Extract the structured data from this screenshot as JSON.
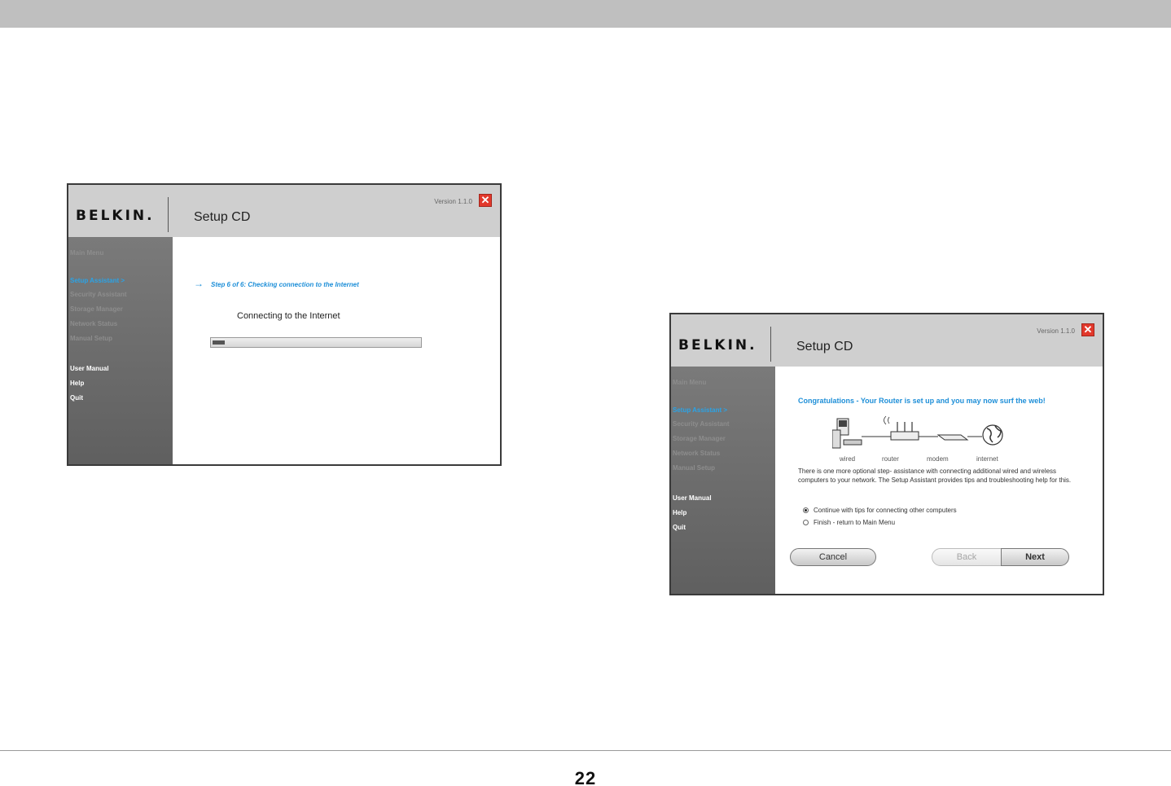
{
  "page": {
    "number": "22"
  },
  "app": {
    "logo": "BELKIN.",
    "title": "Setup CD",
    "version": "Version 1.1.0",
    "close_icon": "✕"
  },
  "sidebar": {
    "main_menu": "Main Menu",
    "setup_assistant": "Setup Assistant  >",
    "security_assistant": "Security Assistant",
    "storage_manager": "Storage Manager",
    "network_status": "Network Status",
    "manual_setup": "Manual Setup",
    "user_manual": "User Manual",
    "help": "Help",
    "quit": "Quit"
  },
  "screen1": {
    "step_arrow": "→",
    "step_text": "Step 6 of 6: Checking connection to the Internet",
    "connecting": "Connecting to the Internet",
    "progress_fraction": 0.06
  },
  "screen2": {
    "congrats": "Congratulations - Your Router is set up and you may now surf the web!",
    "labels": {
      "wired": "wired",
      "router": "router",
      "modem": "modem",
      "internet": "internet"
    },
    "description": "There is one more optional step- assistance with connecting additional wired and wireless computers to your network. The Setup Assistant provides tips and troubleshooting help for this.",
    "options": [
      {
        "label": "Continue with tips for connecting other computers",
        "selected": true
      },
      {
        "label": "Finish - return to Main Menu",
        "selected": false
      }
    ],
    "buttons": {
      "cancel": "Cancel",
      "back": "Back",
      "next": "Next"
    }
  },
  "colors": {
    "accent": "#1e8fd8",
    "close": "#e2382b",
    "header": "#cfcfcf",
    "sidebar": "#666666"
  },
  "icons": {
    "computer": "computer-icon",
    "router": "router-icon",
    "modem": "modem-icon",
    "internet": "globe-icon"
  }
}
